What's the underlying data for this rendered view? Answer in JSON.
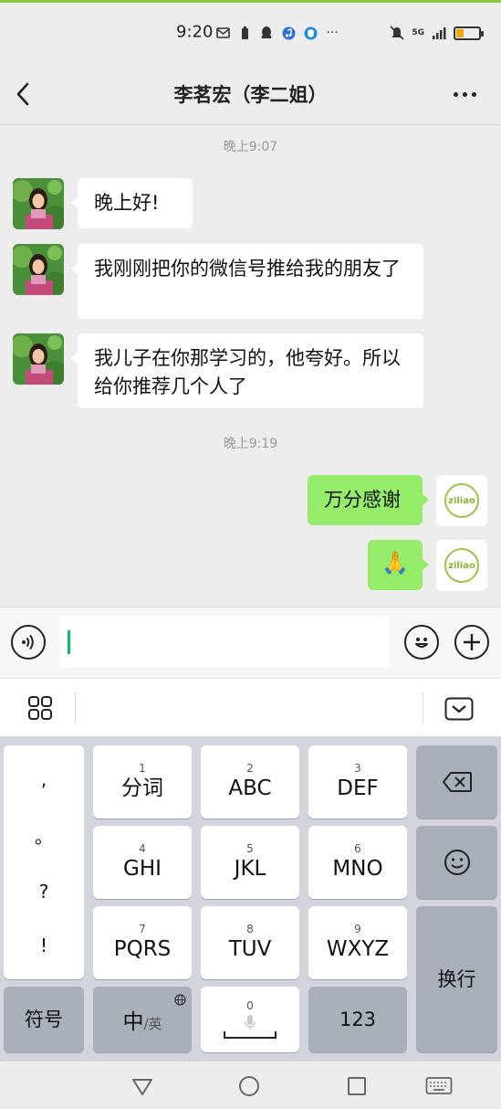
{
  "status_bar": {
    "time": "9:20",
    "network": "5G",
    "colors": {
      "accent_line": "#8dc73f",
      "battery": "#f0a500"
    }
  },
  "header": {
    "title": "李茗宏（李二姐）"
  },
  "messages": {
    "timestamp_1": "晚上9:07",
    "msg_1": "晚上好!",
    "msg_2": "我刚刚把你的微信号推给我的朋友了",
    "msg_3": "我儿子在你那学习的，他夸好。所以给你推荐几个人了",
    "timestamp_2": "晚上9:19",
    "msg_4": "万分感谢",
    "msg_5": "🙏",
    "self_avatar_text": "ziliao"
  },
  "keyboard": {
    "punctuation": [
      ",",
      "。",
      "?",
      "!"
    ],
    "keys": {
      "k1": {
        "num": "1",
        "label": "分词"
      },
      "k2": {
        "num": "2",
        "label": "ABC"
      },
      "k3": {
        "num": "3",
        "label": "DEF"
      },
      "k4": {
        "num": "4",
        "label": "GHI"
      },
      "k5": {
        "num": "5",
        "label": "JKL"
      },
      "k6": {
        "num": "6",
        "label": "MNO"
      },
      "k7": {
        "num": "7",
        "label": "PQRS"
      },
      "k8": {
        "num": "8",
        "label": "TUV"
      },
      "k9": {
        "num": "9",
        "label": "WXYZ"
      },
      "k0": {
        "num": "0"
      }
    },
    "symbols_label": "符号",
    "lang_label_main": "中",
    "lang_label_sub": "/英",
    "numbers_label": "123",
    "enter_label": "换行"
  },
  "icons": [
    "chevron-left-icon",
    "more-icon",
    "voice-icon",
    "emoji-icon",
    "plus-icon",
    "grid-icon",
    "collapse-keyboard-icon",
    "backspace-icon",
    "emoji-key-icon",
    "mic-icon",
    "globe-icon",
    "nav-back-icon",
    "nav-home-icon",
    "nav-recents-icon",
    "nav-keyboard-icon"
  ]
}
